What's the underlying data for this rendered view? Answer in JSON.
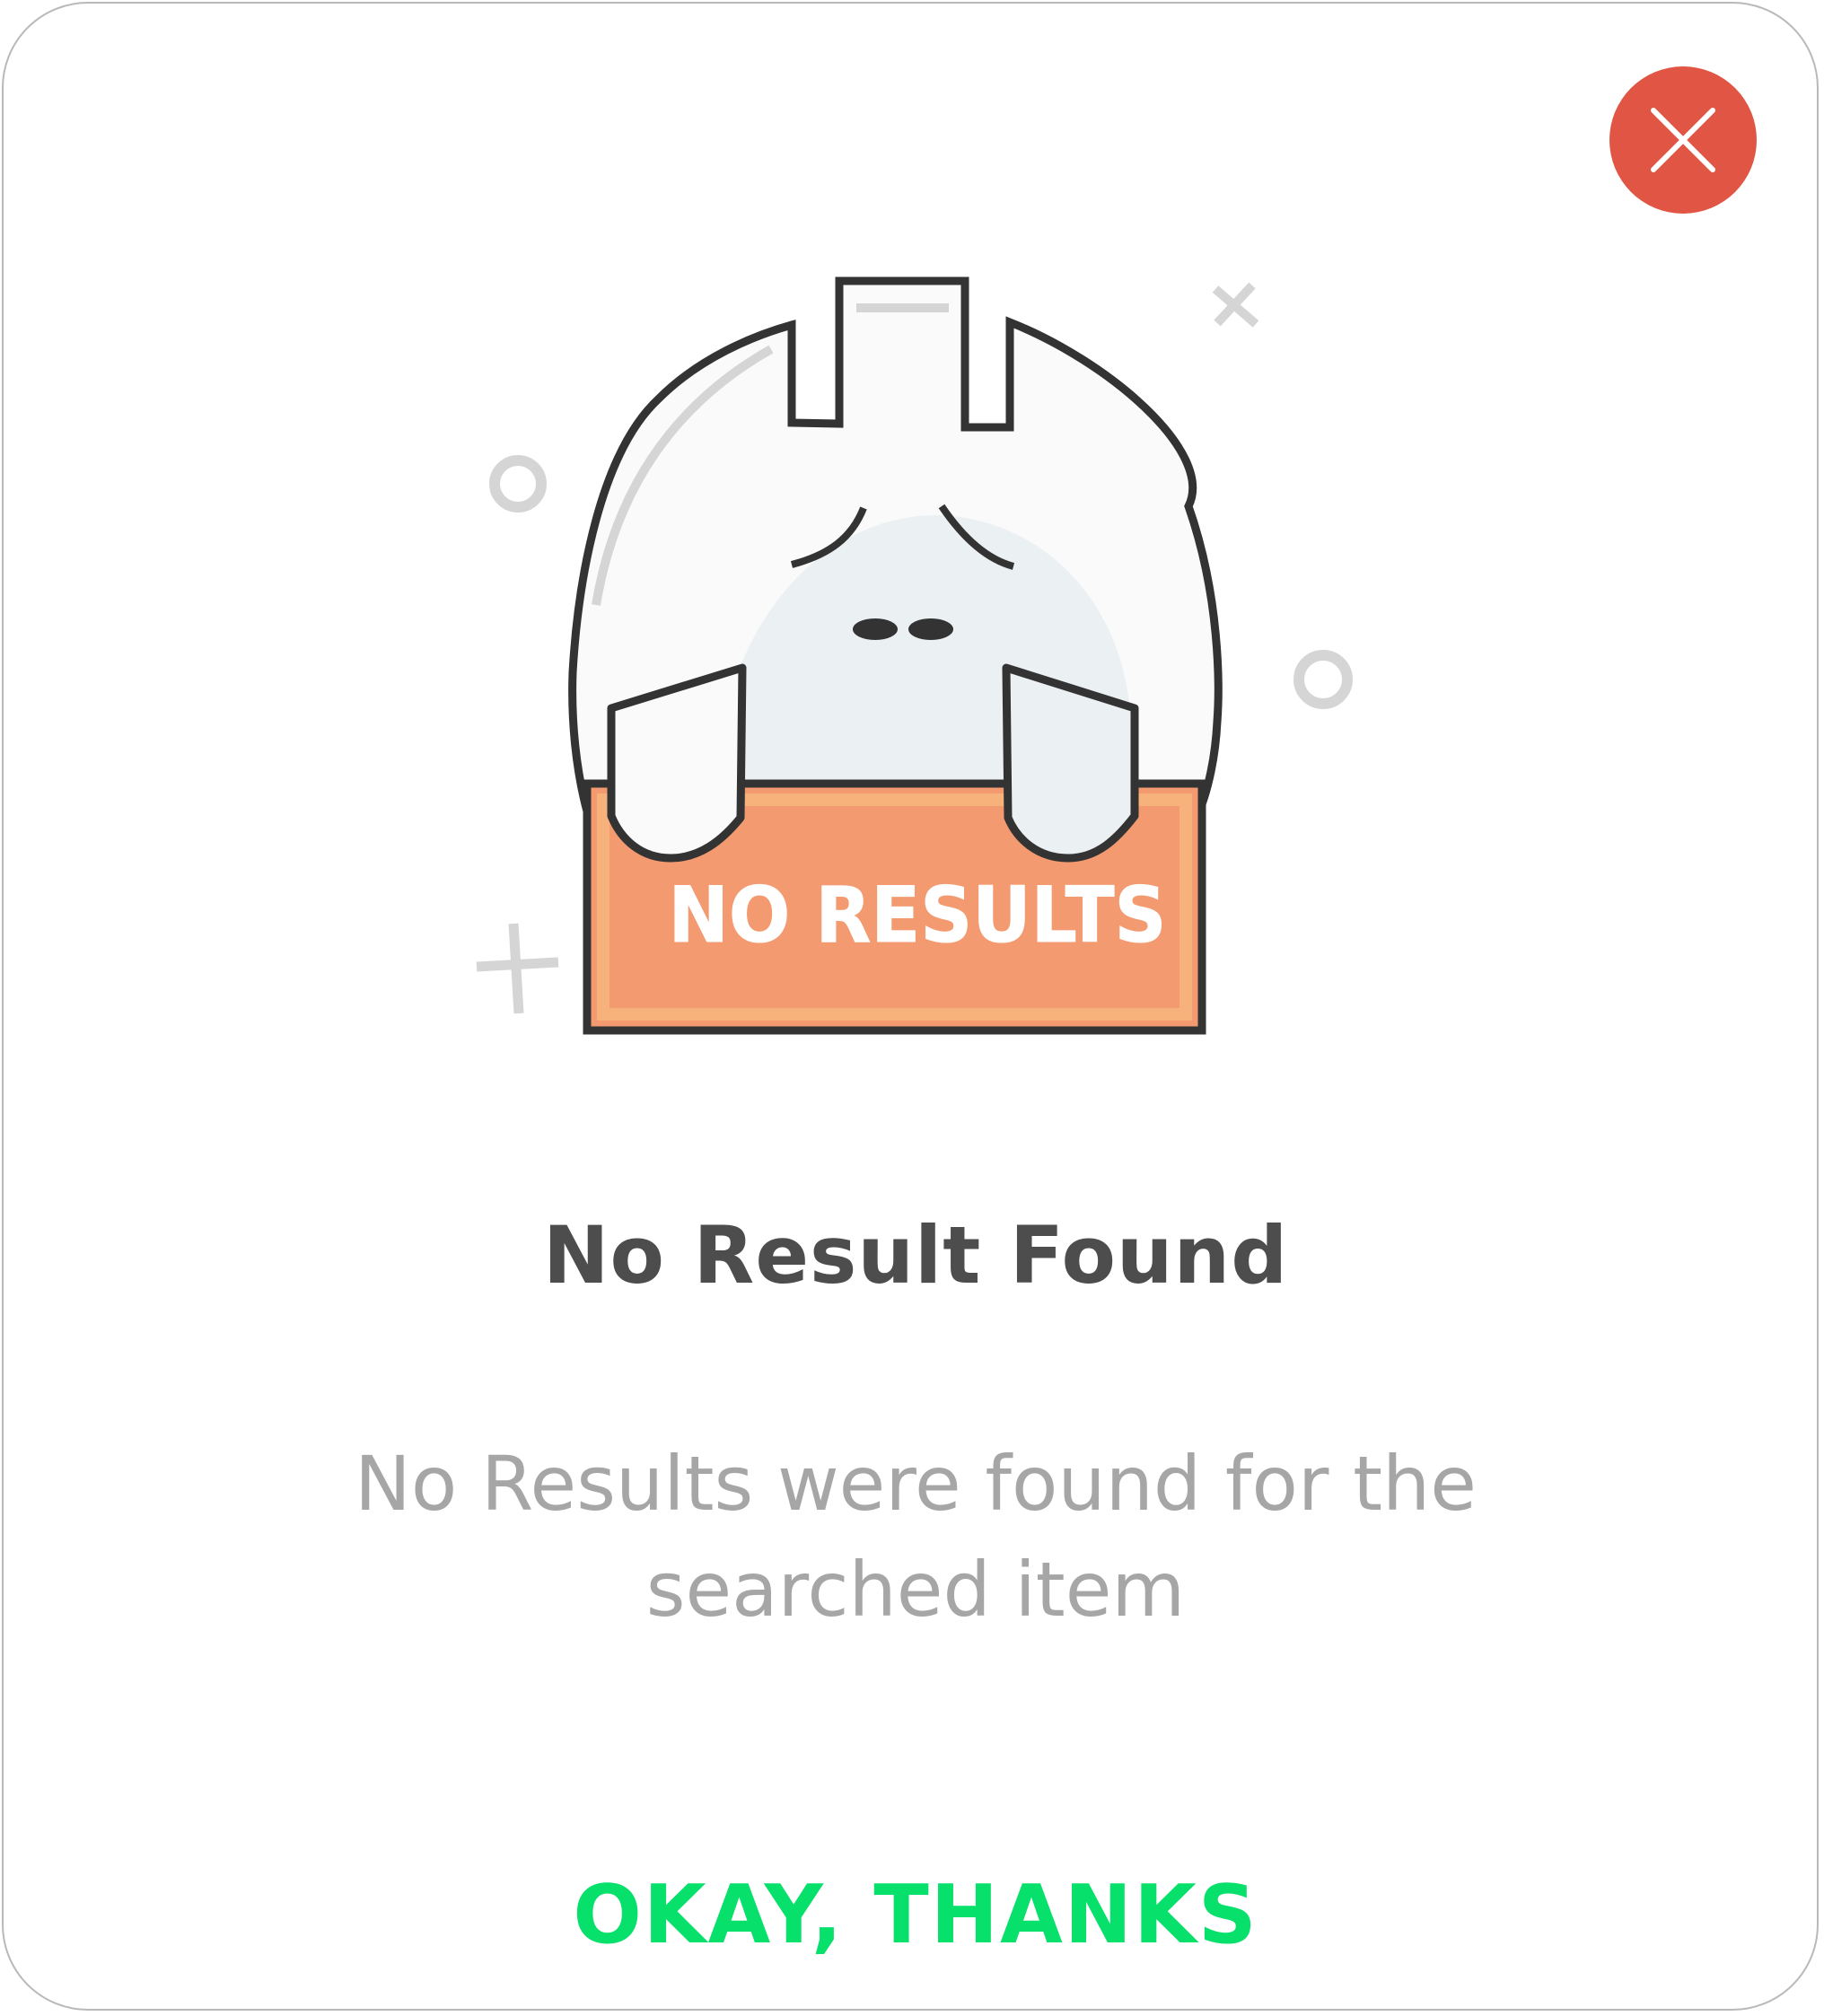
{
  "dialog": {
    "close_icon": "close-icon",
    "illustration": {
      "sign_label": "NO RESULTS",
      "colors": {
        "sign_fill": "#f39a70",
        "sign_inner_border": "#f7b27c",
        "outline": "#333333",
        "face": "#ebf0f3",
        "decoration": "#d5d5d5"
      }
    },
    "title": "No Result Found",
    "message": "No Results were found for the searched item",
    "action_label": "OKAY, THANKS"
  },
  "colors": {
    "close_button": "#e05544",
    "title": "#4d4d4d",
    "message": "#a6a6a6",
    "action": "#07e06a"
  }
}
